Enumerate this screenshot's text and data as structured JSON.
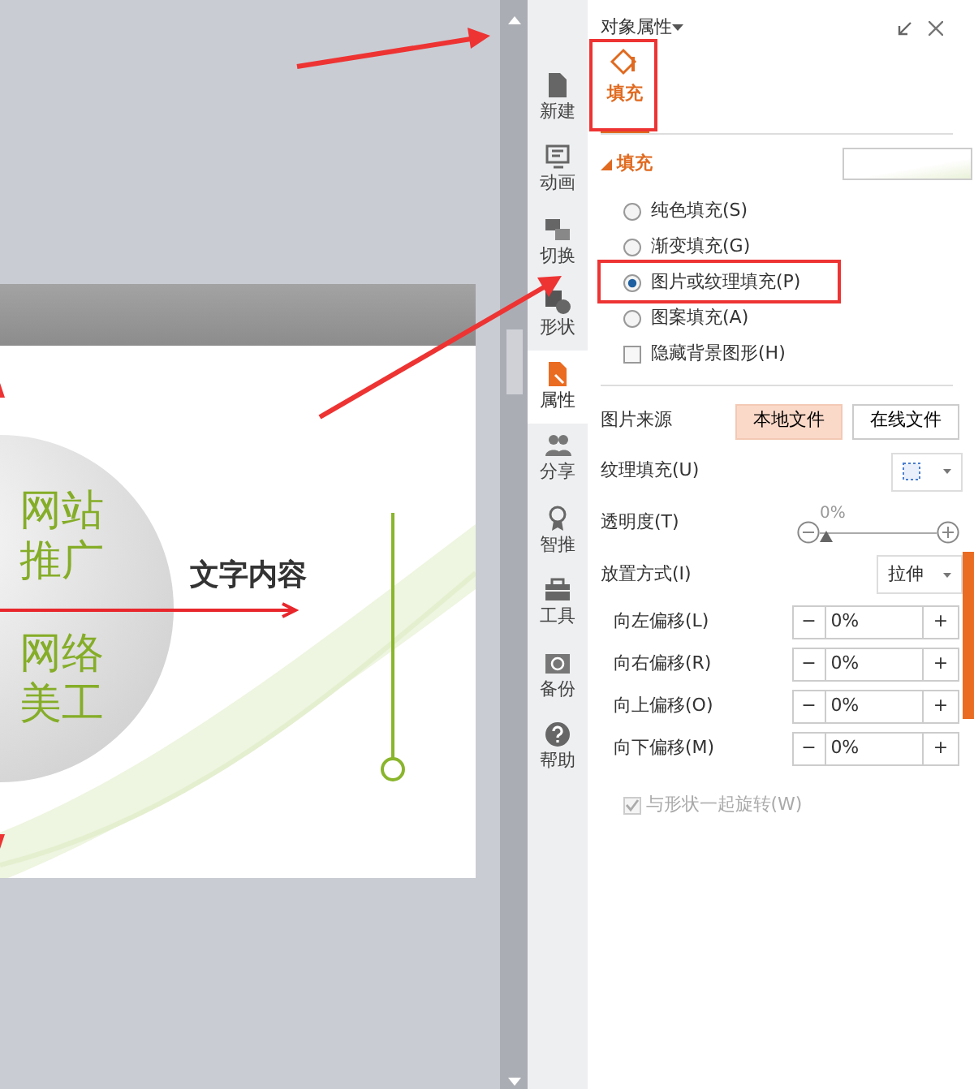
{
  "slide": {
    "circle_labels": [
      "网站推广",
      "网络美工"
    ],
    "caption": "文字内容"
  },
  "side_tabs": [
    {
      "label": "新建",
      "selected": false
    },
    {
      "label": "动画",
      "selected": false
    },
    {
      "label": "切换",
      "selected": false
    },
    {
      "label": "形状",
      "selected": false
    },
    {
      "label": "属性",
      "selected": true
    },
    {
      "label": "分享",
      "selected": false
    },
    {
      "label": "智推",
      "selected": false
    },
    {
      "label": "工具",
      "selected": false
    },
    {
      "label": "备份",
      "selected": false
    },
    {
      "label": "帮助",
      "selected": false
    }
  ],
  "panel": {
    "title": "对象属性",
    "tabs": [
      {
        "label": "填充",
        "selected": true
      }
    ],
    "section": {
      "title": "填充",
      "expanded": true
    },
    "fill_options": [
      {
        "kind": "radio",
        "label": "纯色填充(S)",
        "checked": false
      },
      {
        "kind": "radio",
        "label": "渐变填充(G)",
        "checked": false
      },
      {
        "kind": "radio",
        "label": "图片或纹理填充(P)",
        "checked": true
      },
      {
        "kind": "radio",
        "label": "图案填充(A)",
        "checked": false
      },
      {
        "kind": "checkbox",
        "label": "隐藏背景图形(H)",
        "checked": false
      }
    ],
    "picture_source": {
      "label": "图片来源",
      "buttons": [
        {
          "label": "本地文件",
          "selected": true
        },
        {
          "label": "在线文件",
          "selected": false
        }
      ]
    },
    "texture": {
      "label": "纹理填充(U)"
    },
    "transparency": {
      "label": "透明度(T)",
      "reading": "0%",
      "level": 0
    },
    "placement": {
      "label": "放置方式(I)",
      "value": "拉伸"
    },
    "offsets": [
      {
        "label": "向左偏移(L)",
        "value": "0%",
        "minus": "−",
        "plus": "+"
      },
      {
        "label": "向右偏移(R)",
        "value": "0%",
        "minus": "−",
        "plus": "+"
      },
      {
        "label": "向上偏移(O)",
        "value": "0%",
        "minus": "−",
        "plus": "+"
      },
      {
        "label": "向下偏移(M)",
        "value": "0%",
        "minus": "−",
        "plus": "+"
      }
    ],
    "rotate": {
      "label": "与形状一起旋转(W)",
      "checked": true,
      "disabled": true
    }
  }
}
